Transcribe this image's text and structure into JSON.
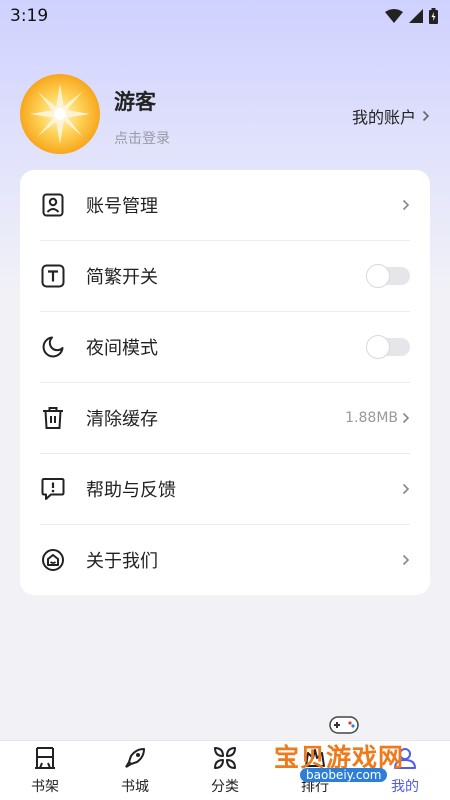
{
  "status_bar": {
    "time": "3:19"
  },
  "profile": {
    "username": "游客",
    "login_hint": "点击登录",
    "account_link": "我的账户"
  },
  "menu": {
    "items": [
      {
        "label": "账号管理",
        "icon": "user-square-icon",
        "trailing": "chevron"
      },
      {
        "label": "简繁开关",
        "icon": "text-t-icon",
        "trailing": "toggle",
        "toggle_on": false
      },
      {
        "label": "夜间模式",
        "icon": "moon-icon",
        "trailing": "toggle",
        "toggle_on": false
      },
      {
        "label": "清除缓存",
        "icon": "trash-icon",
        "trailing": "value",
        "value": "1.88MB"
      },
      {
        "label": "帮助与反馈",
        "icon": "feedback-icon",
        "trailing": "chevron"
      },
      {
        "label": "关于我们",
        "icon": "about-icon",
        "trailing": "chevron"
      }
    ]
  },
  "bottom_nav": {
    "items": [
      {
        "label": "书架",
        "icon": "bookshelf-icon",
        "active": false
      },
      {
        "label": "书城",
        "icon": "rocket-icon",
        "active": false
      },
      {
        "label": "分类",
        "icon": "category-icon",
        "active": false
      },
      {
        "label": "排行",
        "icon": "ranking-icon",
        "active": false
      },
      {
        "label": "我的",
        "icon": "profile-icon",
        "active": true
      }
    ]
  },
  "watermark": {
    "text": "宝贝游戏网",
    "url": "baobeiy.com"
  },
  "colors": {
    "accent": "#4f5cf0",
    "background": "#f2f2f6",
    "header_gradient_top": "#cfd1ff"
  }
}
